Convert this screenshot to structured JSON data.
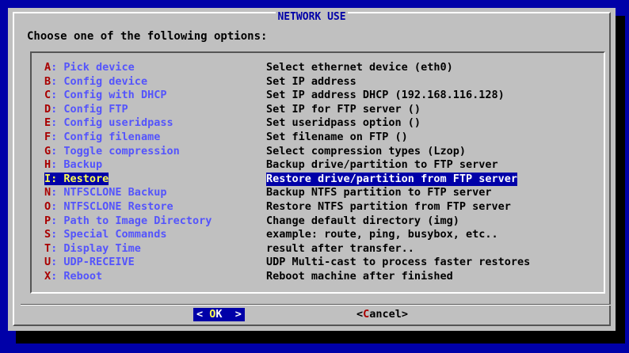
{
  "dialog": {
    "title": "NETWORK USE",
    "prompt": "Choose one of the following options:"
  },
  "menu": {
    "selected_index": 8,
    "items": [
      {
        "key": "A",
        "sep": ": ",
        "label": "Pick device",
        "desc": "Select ethernet device (eth0)"
      },
      {
        "key": "B",
        "sep": ": ",
        "label": "Config device",
        "desc": "Set IP address"
      },
      {
        "key": "C",
        "sep": ": ",
        "label": "Config with DHCP",
        "desc": "Set IP address DHCP (192.168.116.128)"
      },
      {
        "key": "D",
        "sep": ": ",
        "label": "Config FTP",
        "desc": "Set IP for FTP server ()"
      },
      {
        "key": "E",
        "sep": ": ",
        "label": "Config useridpass",
        "desc": "Set useridpass option ()"
      },
      {
        "key": "F",
        "sep": ": ",
        "label": "Config filename",
        "desc": "Set filename on FTP ()"
      },
      {
        "key": "G",
        "sep": ": ",
        "label": "Toggle compression",
        "desc": "Select compression types (Lzop)"
      },
      {
        "key": "H",
        "sep": ": ",
        "label": "Backup",
        "desc": "Backup drive/partition to FTP server"
      },
      {
        "key": "I",
        "sep": ": ",
        "label": "Restore",
        "desc": "Restore drive/partition from FTP server"
      },
      {
        "key": "N",
        "sep": ": ",
        "label": "NTFSCLONE Backup",
        "desc": "Backup NTFS partition to FTP server"
      },
      {
        "key": "O",
        "sep": ": ",
        "label": "NTFSCLONE Restore",
        "desc": "Restore NTFS partition from FTP server"
      },
      {
        "key": "P",
        "sep": ": ",
        "label": "Path to Image Directory",
        "desc": "Change default directory (img)"
      },
      {
        "key": "S",
        "sep": ": ",
        "label": "Special Commands",
        "desc": "example: route, ping, busybox, etc.."
      },
      {
        "key": "T",
        "sep": ": ",
        "label": "Display Time",
        "desc": "result after transfer.."
      },
      {
        "key": "U",
        "sep": ": ",
        "label": "UDP-RECEIVE",
        "desc": "UDP Multi-cast to process faster restores"
      },
      {
        "key": "X",
        "sep": ": ",
        "label": "Reboot",
        "desc": "Reboot machine after finished"
      }
    ]
  },
  "buttons": {
    "ok": {
      "left": "< ",
      "key": "O",
      "rest": "K",
      "right": "  >"
    },
    "cancel": {
      "left": "<",
      "key": "C",
      "rest": "ancel",
      "right": ">"
    }
  },
  "colors": {
    "desktop": "#0000a8",
    "dialog": "#c0c0c0",
    "hotkey": "#a80000",
    "label": "#5454fc",
    "selection_bg": "#0000a8",
    "selection_fg": "#fcfc54"
  }
}
